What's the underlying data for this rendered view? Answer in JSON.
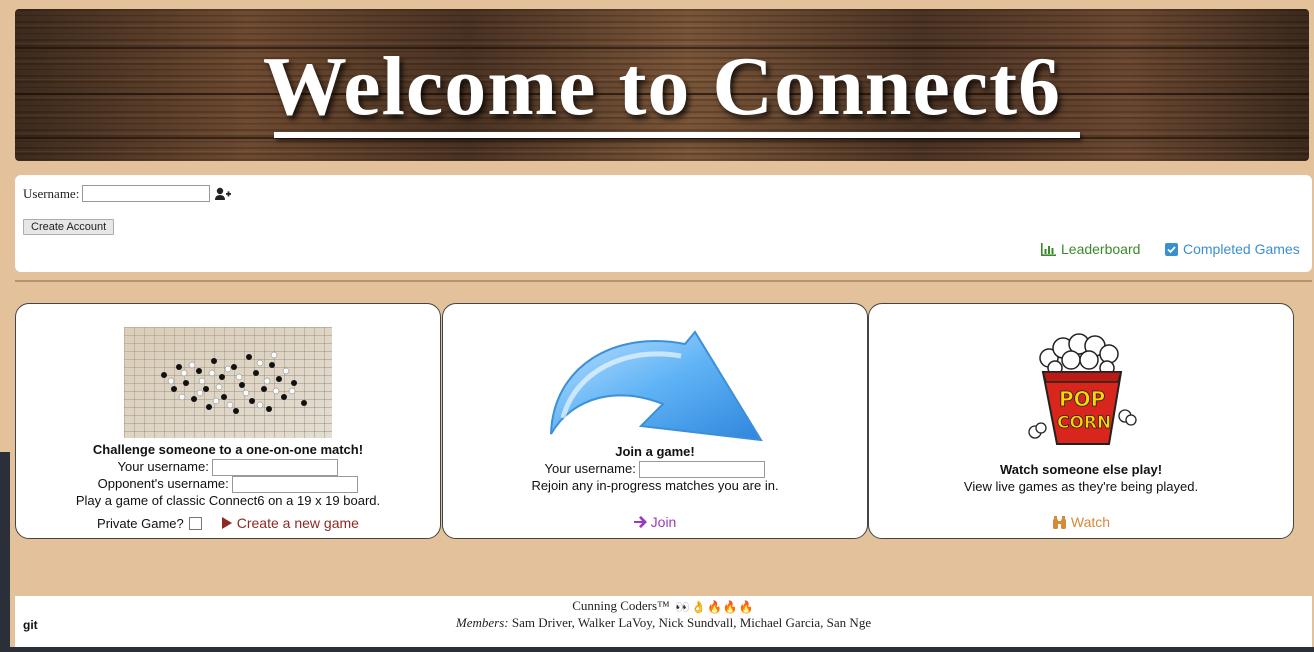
{
  "banner": {
    "title": "Welcome to Connect6"
  },
  "account": {
    "username_label": "Username:",
    "username_value": "",
    "create_button": "Create Account",
    "leaderboard_label": "Leaderboard",
    "completed_label": "Completed Games"
  },
  "challenge": {
    "heading": "Challenge someone to a one-on-one match!",
    "your_username_label": "Your username:",
    "opponent_username_label": "Opponent's username:",
    "description": "Play a game of classic Connect6 on a 19 x 19 board.",
    "private_label": "Private Game?",
    "create_link": "Create a new game"
  },
  "join": {
    "heading": "Join a game!",
    "your_username_label": "Your username:",
    "description": "Rejoin any in-progress matches you are in.",
    "join_link": "Join"
  },
  "watch": {
    "heading": "Watch someone else play!",
    "description": "View live games as they're being played.",
    "watch_link": "Watch"
  },
  "footer": {
    "git": "git",
    "team": "Cunning Coders™",
    "emojis": [
      "👀",
      "👌",
      "🔥",
      "🔥",
      "🔥"
    ],
    "members_label": "Members:",
    "members": "Sam Driver, Walker LaVoy, Nick Sundvall, Michael Garcia, San Nge"
  },
  "colors": {
    "page_bg": "#e3c29b",
    "leaderboard": "#3a8a2a",
    "completed": "#3a8fd0",
    "create_link": "#8b2b23",
    "join_link": "#9a3bbd",
    "watch_link": "#d68a3a"
  },
  "icons": {
    "add_user": "user-plus-icon",
    "leaderboard": "bar-chart-icon",
    "completed": "check-square-icon",
    "create": "play-icon",
    "join": "arrow-right-icon",
    "watch": "binoculars-icon"
  }
}
